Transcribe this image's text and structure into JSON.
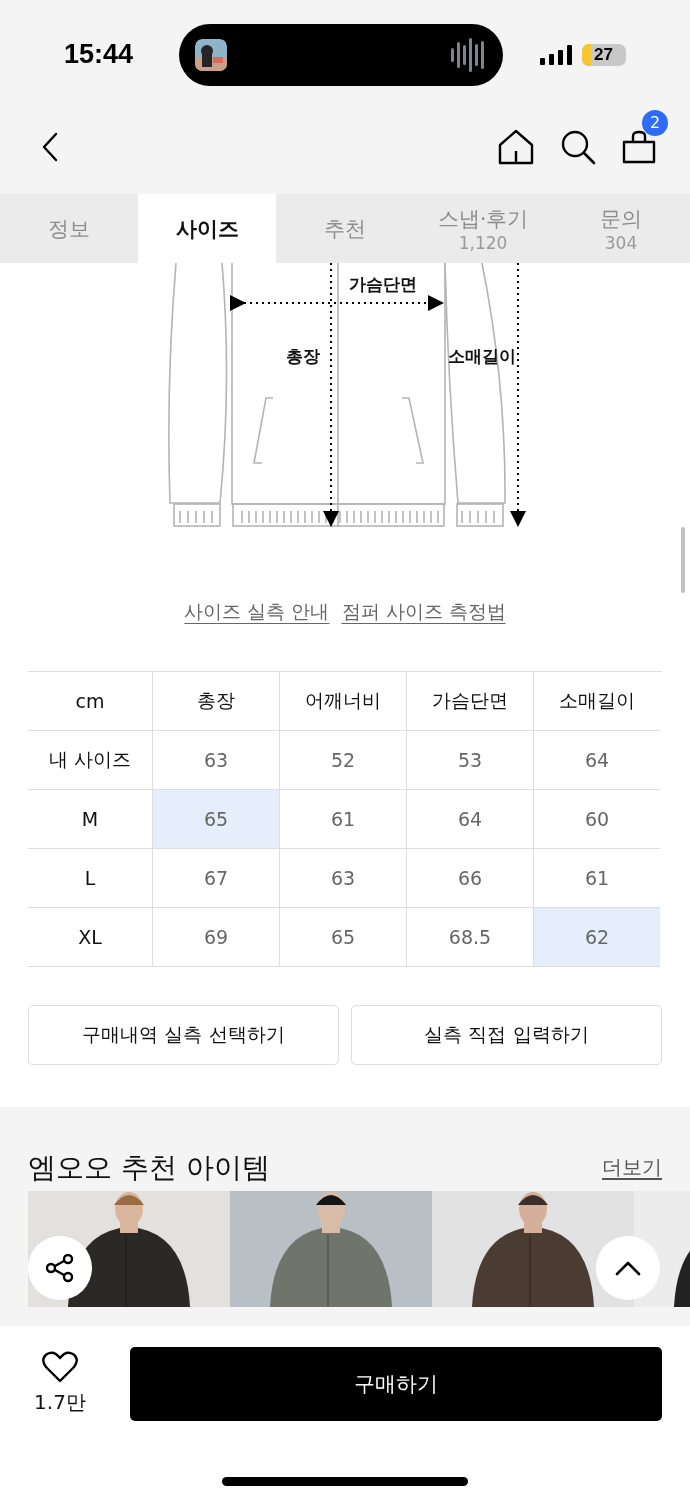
{
  "status_bar": {
    "time": "15:44",
    "battery": "27"
  },
  "nav": {
    "cart_count": "2"
  },
  "tabs": [
    {
      "label": "정보",
      "selected": false
    },
    {
      "label": "사이즈",
      "selected": true
    },
    {
      "label": "추천",
      "selected": false
    },
    {
      "label": "스냅·후기",
      "count": "1,120",
      "selected": false
    },
    {
      "label": "문의",
      "count": "304",
      "selected": false
    }
  ],
  "diagram": {
    "labels": [
      "가슴단면",
      "총장",
      "소매길이"
    ]
  },
  "guide_links": [
    "사이즈 실측 안내",
    "점퍼 사이즈 측정법"
  ],
  "size_table": {
    "columns": [
      "cm",
      "총장",
      "어깨너비",
      "가슴단면",
      "소매길이"
    ],
    "rows": [
      {
        "cells": [
          {
            "value": "내 사이즈",
            "highlighted": false
          },
          {
            "value": "63",
            "highlighted": false
          },
          {
            "value": "52",
            "highlighted": false
          },
          {
            "value": "53",
            "highlighted": false
          },
          {
            "value": "64",
            "highlighted": false
          }
        ]
      },
      {
        "cells": [
          {
            "value": "M",
            "highlighted": false
          },
          {
            "value": "65",
            "highlighted": true
          },
          {
            "value": "61",
            "highlighted": false
          },
          {
            "value": "64",
            "highlighted": false
          },
          {
            "value": "60",
            "highlighted": false
          }
        ]
      },
      {
        "cells": [
          {
            "value": "L",
            "highlighted": false
          },
          {
            "value": "67",
            "highlighted": false
          },
          {
            "value": "63",
            "highlighted": false
          },
          {
            "value": "66",
            "highlighted": false
          },
          {
            "value": "61",
            "highlighted": false
          }
        ]
      },
      {
        "cells": [
          {
            "value": "XL",
            "highlighted": false
          },
          {
            "value": "69",
            "highlighted": false
          },
          {
            "value": "65",
            "highlighted": false
          },
          {
            "value": "68.5",
            "highlighted": false
          },
          {
            "value": "62",
            "highlighted": true
          }
        ]
      }
    ]
  },
  "actions": [
    "구매내역 실측 선택하기",
    "실측 직접 입력하기"
  ],
  "recommend": {
    "title": "엠오오 추천 아이템",
    "more": "더보기"
  },
  "bottom_bar": {
    "likes": "1.7만",
    "buy": "구매하기"
  }
}
